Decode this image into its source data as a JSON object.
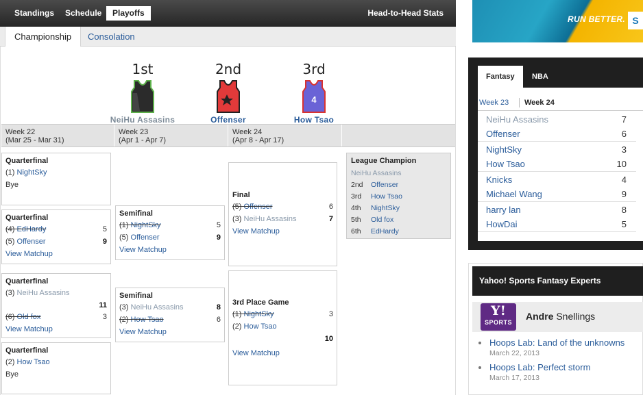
{
  "nav": {
    "tabs": [
      {
        "label": "Standings"
      },
      {
        "label": "Schedule"
      },
      {
        "label": "Playoffs"
      }
    ],
    "h2h": "Head-to-Head Stats"
  },
  "subnav": {
    "championship": "Championship",
    "consolation": "Consolation"
  },
  "podium": [
    {
      "rank": "1st",
      "team": "NeiHu Assasins",
      "jersey_color": "#2b2b2b",
      "trim": "#5db04a"
    },
    {
      "rank": "2nd",
      "team": "Offenser",
      "jersey_color": "#e23a3a",
      "trim": "#222222"
    },
    {
      "rank": "3rd",
      "team": "How Tsao",
      "jersey_color": "#6a63d6",
      "trim": "#d9322f",
      "number": "4"
    }
  ],
  "weeks": [
    {
      "name": "Week 22",
      "dates": "(Mar 25 - Mar 31)"
    },
    {
      "name": "Week 23",
      "dates": "(Apr 1 - Apr 7)"
    },
    {
      "name": "Week 24",
      "dates": "(Apr 8 - Apr 17)"
    }
  ],
  "bracket": {
    "qf1": {
      "title": "Quarterfinal",
      "seed1": "(1)",
      "team1": "NightSky",
      "bye": "Bye"
    },
    "qf2": {
      "title": "Quarterfinal",
      "seed1": "(4)",
      "team1": "EdHardy",
      "score1": "5",
      "seed2": "(5)",
      "team2": "Offenser",
      "score2": "9",
      "view": "View Matchup"
    },
    "qf3": {
      "title": "Quarterfinal",
      "seed1": "(3)",
      "team1": "NeiHu Assasins",
      "score1": "11",
      "seed2": "(6)",
      "team2": "Old fox",
      "score2": "3",
      "view": "View Matchup"
    },
    "qf4": {
      "title": "Quarterfinal",
      "seed1": "(2)",
      "team1": "How Tsao",
      "bye": "Bye"
    },
    "sf1": {
      "title": "Semifinal",
      "seed1": "(1)",
      "team1": "NightSky",
      "score1": "5",
      "seed2": "(5)",
      "team2": "Offenser",
      "score2": "9",
      "view": "View Matchup"
    },
    "sf2": {
      "title": "Semifinal",
      "seed1": "(3)",
      "team1": "NeiHu Assasins",
      "score1": "8",
      "seed2": "(2)",
      "team2": "How Tsao",
      "score2": "6",
      "view": "View Matchup"
    },
    "final": {
      "title": "Final",
      "seed1": "(5)",
      "team1": "Offenser",
      "score1": "6",
      "seed2": "(3)",
      "team2": "NeiHu Assasins",
      "score2": "7",
      "view": "View Matchup"
    },
    "third": {
      "title": "3rd Place Game",
      "seed1": "(1)",
      "team1": "NightSky",
      "score1": "3",
      "seed2": "(2)",
      "team2": "How Tsao",
      "score2": "10",
      "view": "View Matchup"
    }
  },
  "champion": {
    "title": "League Champion",
    "winner": "NeiHu Assasins",
    "places": [
      {
        "place": "2nd",
        "team": "Offenser"
      },
      {
        "place": "3rd",
        "team": "How Tsao"
      },
      {
        "place": "4th",
        "team": "NightSky"
      },
      {
        "place": "5th",
        "team": "Old fox"
      },
      {
        "place": "6th",
        "team": "EdHardy"
      }
    ]
  },
  "ad": {
    "text": "RUN BETTER.",
    "logo": "S"
  },
  "fantasy": {
    "tabs": [
      "Fantasy",
      "NBA"
    ],
    "weeks": [
      "Week 23",
      "Week 24"
    ],
    "matchups": [
      [
        {
          "team": "NeiHu Assasins",
          "score": "7"
        },
        {
          "team": "Offenser",
          "score": "6"
        }
      ],
      [
        {
          "team": "NightSky",
          "score": "3"
        },
        {
          "team": "How Tsao",
          "score": "10"
        }
      ],
      [
        {
          "team": "Knicks",
          "score": "4"
        },
        {
          "team": "Michael Wang",
          "score": "9"
        }
      ],
      [
        {
          "team": "harry lan",
          "score": "8"
        },
        {
          "team": "HowDai",
          "score": "5"
        }
      ]
    ]
  },
  "experts": {
    "header": "Yahoo! Sports Fantasy Experts",
    "logo_top": "Y!",
    "logo_bottom": "SPORTS",
    "first": "Andre",
    "last": "Snellings",
    "articles": [
      {
        "title": "Hoops Lab: Land of the unknowns",
        "date": "March 22, 2013"
      },
      {
        "title": "Hoops Lab: Perfect storm",
        "date": "March 17, 2013"
      }
    ]
  }
}
